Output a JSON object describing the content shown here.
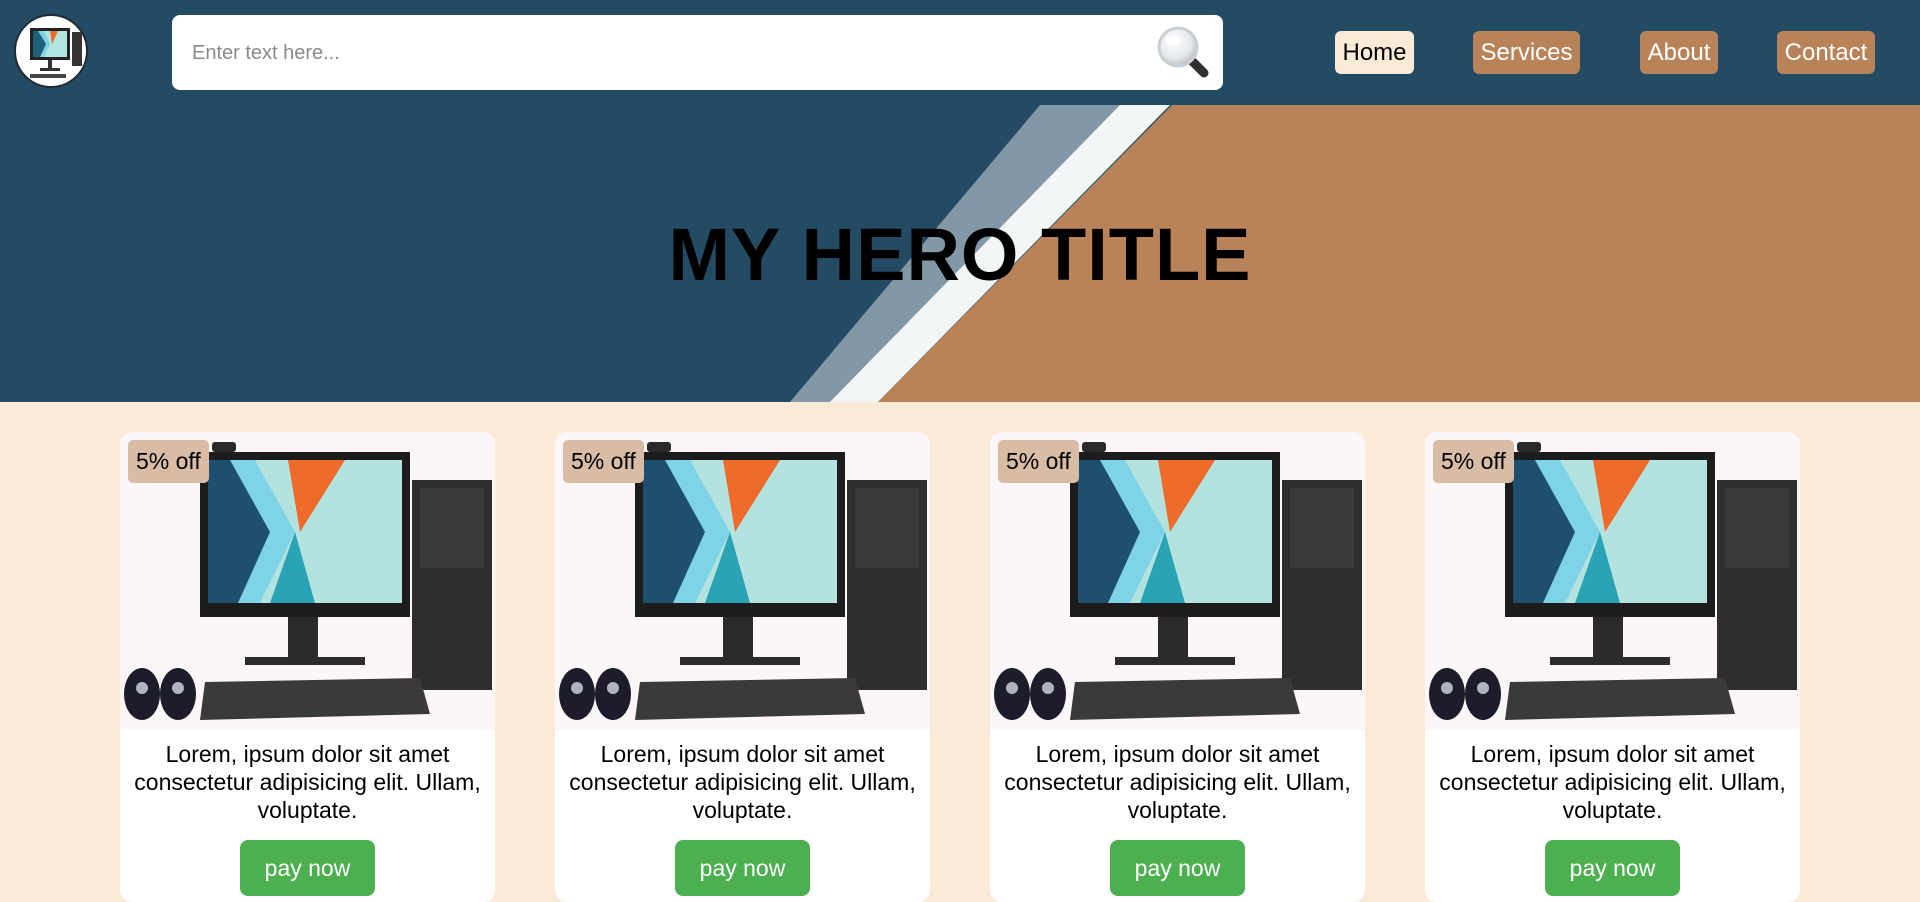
{
  "header": {
    "logo_icon": "monitor-logo-icon",
    "search": {
      "placeholder": "Enter text here...",
      "value": "",
      "icon": "magnifier-icon"
    },
    "nav": [
      {
        "label": "Home",
        "active": true
      },
      {
        "label": "Services",
        "active": false
      },
      {
        "label": "About",
        "active": false
      },
      {
        "label": "Contact",
        "active": false
      }
    ]
  },
  "hero": {
    "title": "MY HERO TITLE"
  },
  "products": [
    {
      "badge": "5% off",
      "description": "Lorem, ipsum dolor sit amet consectetur adipisicing elit. Ullam, voluptate.",
      "button": "pay now",
      "image_icon": "desktop-computer-icon"
    },
    {
      "badge": "5% off",
      "description": "Lorem, ipsum dolor sit amet consectetur adipisicing elit. Ullam, voluptate.",
      "button": "pay now",
      "image_icon": "desktop-computer-icon"
    },
    {
      "badge": "5% off",
      "description": "Lorem, ipsum dolor sit amet consectetur adipisicing elit. Ullam, voluptate.",
      "button": "pay now",
      "image_icon": "desktop-computer-icon"
    },
    {
      "badge": "5% off",
      "description": "Lorem, ipsum dolor sit amet consectetur adipisicing elit. Ullam, voluptate.",
      "button": "pay now",
      "image_icon": "desktop-computer-icon"
    }
  ],
  "colors": {
    "header_bg": "#244b64",
    "accent": "#b88358",
    "page_bg": "#faebd7",
    "pay_button": "#4caf50",
    "badge_bg": "#d8bca5"
  }
}
